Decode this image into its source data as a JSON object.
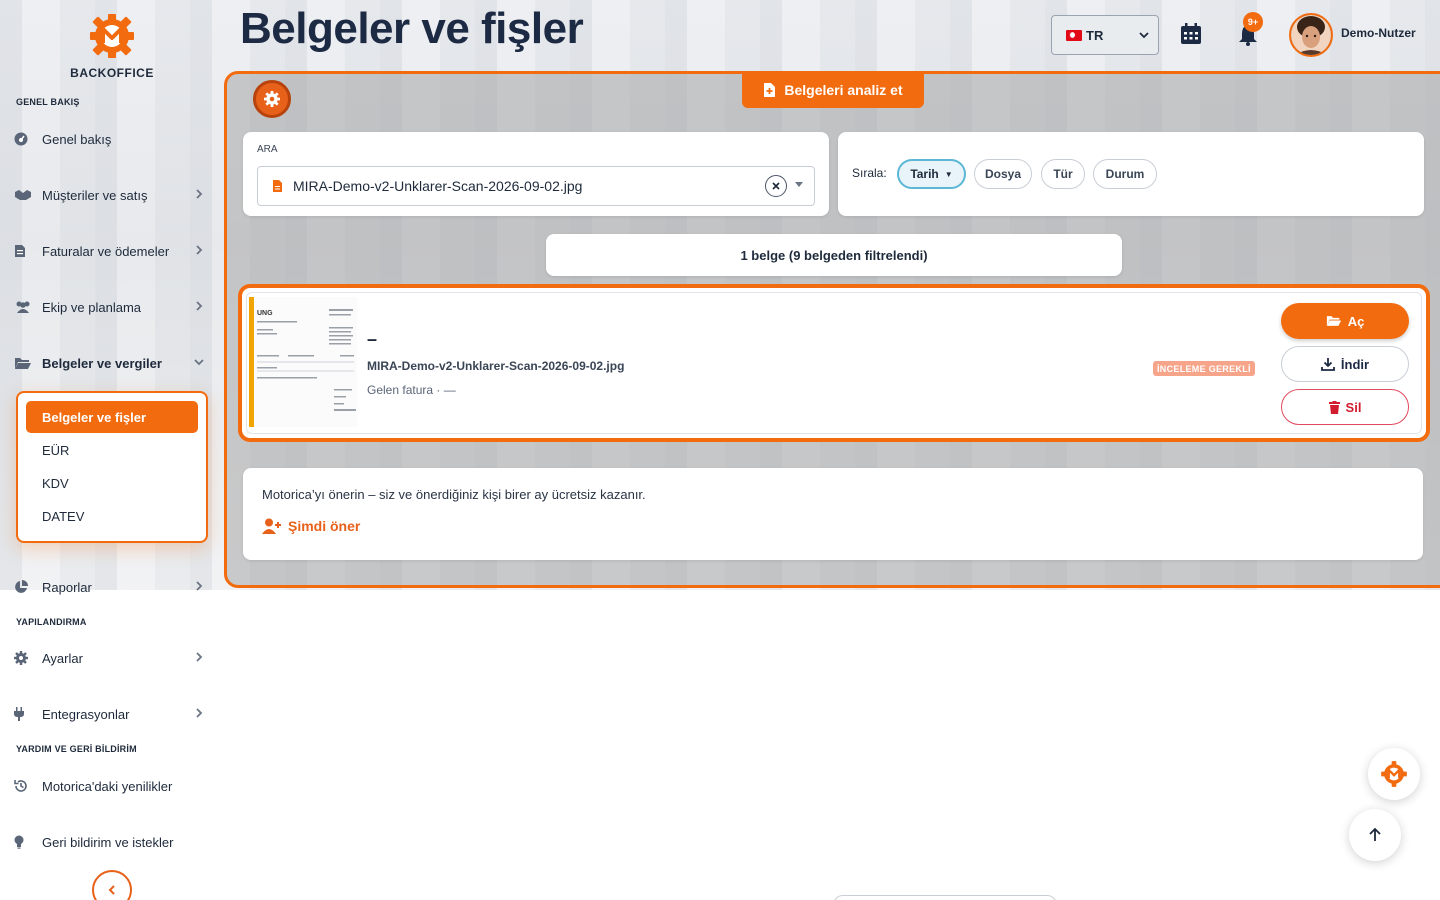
{
  "brand": {
    "name": "BACKOFFICE"
  },
  "sidebar": {
    "sections": [
      {
        "label": "GENEL BAKIŞ"
      },
      {
        "label": "YAPILANDIRMA"
      },
      {
        "label": "YARDIM VE GERİ BİLDİRİM"
      }
    ],
    "items": [
      {
        "label": "Genel bakış",
        "icon": "dashboard-icon"
      },
      {
        "label": "Müşteriler ve satış",
        "icon": "handshake-icon"
      },
      {
        "label": "Faturalar ve ödemeler",
        "icon": "invoice-icon"
      },
      {
        "label": "Ekip ve planlama",
        "icon": "users-icon"
      },
      {
        "label": "Belgeler ve vergiler",
        "icon": "folder-open-icon"
      },
      {
        "label": "Raporlar",
        "icon": "pie-chart-icon"
      },
      {
        "label": "Ayarlar",
        "icon": "gear-icon"
      },
      {
        "label": "Entegrasyonlar",
        "icon": "plug-icon"
      },
      {
        "label": "Motorica'daki yenilikler",
        "icon": "history-icon"
      },
      {
        "label": "Geri bildirim ve istekler",
        "icon": "lightbulb-icon"
      }
    ],
    "subitems": [
      "Belgeler ve fişler",
      "EÜR",
      "KDV",
      "DATEV"
    ]
  },
  "header": {
    "title": "Belgeler ve fişler",
    "language": "TR",
    "notification_count": "9+",
    "user_name": "Demo-Nutzer"
  },
  "toolbar": {
    "analyze_label": "Belgeleri analiz et"
  },
  "search": {
    "label": "ARA",
    "value": "MIRA-Demo-v2-Unklarer-Scan-2026-09-02.jpg"
  },
  "sort": {
    "label": "Sırala:",
    "options": [
      "Tarih",
      "Dosya",
      "Tür",
      "Durum"
    ],
    "active": "Tarih",
    "direction_glyph": "▼"
  },
  "results": {
    "summary": "1 belge (9 belgeden filtrelendi)"
  },
  "document": {
    "title": "–",
    "filename": "MIRA-Demo-v2-Unklarer-Scan-2026-09-02.jpg",
    "meta": "Gelen fatura · —",
    "status": "İNCELEME GEREKLİ",
    "actions": {
      "open": "Aç",
      "download": "İndir",
      "delete": "Sil"
    }
  },
  "referral": {
    "text": "Motorica’yı önerin – siz ve önerdiğiniz kişi birer ay ücretsiz kazanır.",
    "link": "Şimdi öner"
  },
  "colors": {
    "accent": "#f26b0f",
    "navy": "#1d2a44",
    "danger": "#d31b2f",
    "sort_active": "#5bb7d5"
  }
}
